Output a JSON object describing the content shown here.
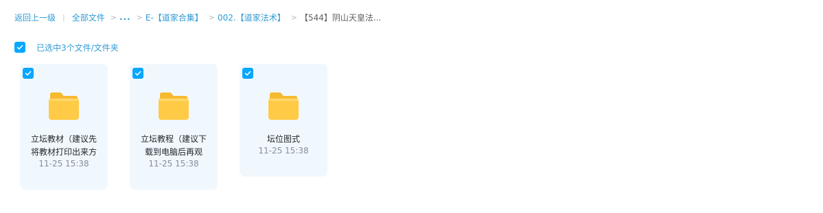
{
  "breadcrumb": {
    "back": "返回上一级",
    "all_files": "全部文件",
    "ellipsis": "...",
    "level1": "E-【道家合集】",
    "level2": "002.【道家法术】",
    "current": "【544】阴山天皇法..."
  },
  "selection": {
    "text": "已选中3个文件/文件夹",
    "checked": true
  },
  "files": [
    {
      "name_line1": "立坛教材（建议先",
      "name_line2": "将教材打印出来方",
      "time": "11-25 15:38",
      "type": "folder",
      "selected": true
    },
    {
      "name_line1": "立坛教程（建议下",
      "name_line2": "载到电脑后再观",
      "time": "11-25 15:38",
      "type": "folder",
      "selected": true
    },
    {
      "name_line1": "坛位图式",
      "name_line2": "",
      "time": "11-25 15:38",
      "type": "folder",
      "selected": true
    }
  ],
  "colors": {
    "accent": "#06a7ff",
    "link": "#2e9bd6",
    "card_bg": "#f1f8fd",
    "folder": "#ffc94d"
  },
  "icons": [
    "check-icon",
    "folder-icon"
  ]
}
